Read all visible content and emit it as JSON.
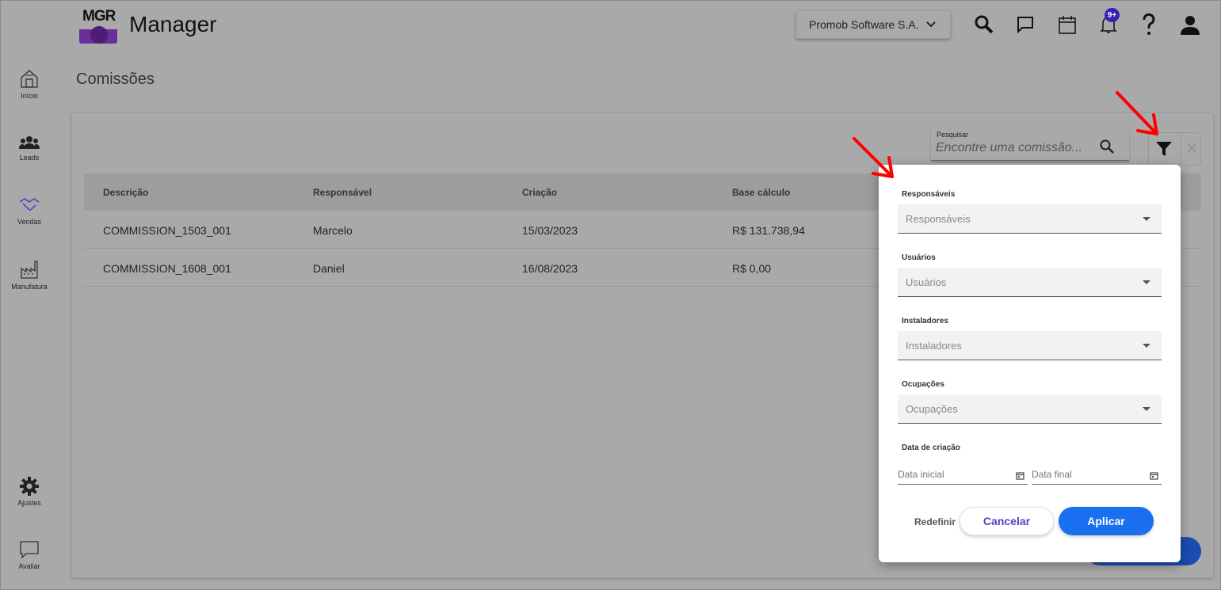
{
  "app": {
    "logo_text": "MGR",
    "title": "Manager",
    "company": "Promob Software S.A.",
    "notifications_badge": "9+"
  },
  "sidebar": {
    "items": [
      {
        "label": "Início",
        "icon": "home-icon"
      },
      {
        "label": "Leads",
        "icon": "people-icon"
      },
      {
        "label": "Vendas",
        "icon": "handshake-icon"
      },
      {
        "label": "Manufatura",
        "icon": "factory-icon"
      },
      {
        "label": "Ajustes",
        "icon": "gear-icon"
      },
      {
        "label": "Avaliar",
        "icon": "chat-icon"
      }
    ]
  },
  "page": {
    "title": "Comissões"
  },
  "search": {
    "label": "Pesquisar",
    "placeholder": "Encontre uma comissão..."
  },
  "table": {
    "columns": [
      "Descrição",
      "Responsável",
      "Criação",
      "Base cálculo"
    ],
    "rows": [
      [
        "COMMISSION_1503_001",
        "Marcelo",
        "15/03/2023",
        "R$ 131.738,94"
      ],
      [
        "COMMISSION_1608_001",
        "Daniel",
        "16/08/2023",
        "R$ 0,00"
      ]
    ]
  },
  "filter": {
    "fields": [
      {
        "label": "Responsáveis",
        "placeholder": "Responsáveis"
      },
      {
        "label": "Usuários",
        "placeholder": "Usuários"
      },
      {
        "label": "Instaladores",
        "placeholder": "Instaladores"
      },
      {
        "label": "Ocupações",
        "placeholder": "Ocupações"
      }
    ],
    "date_label": "Data de criação",
    "date_start": "Data inicial",
    "date_end": "Data final",
    "reset_label": "Redefinir",
    "cancel_label": "Cancelar",
    "apply_label": "Aplicar"
  },
  "colors": {
    "accent": "#1a6ff0",
    "annotation": "#ff0000",
    "brand_purple": "#6a2d9c"
  }
}
